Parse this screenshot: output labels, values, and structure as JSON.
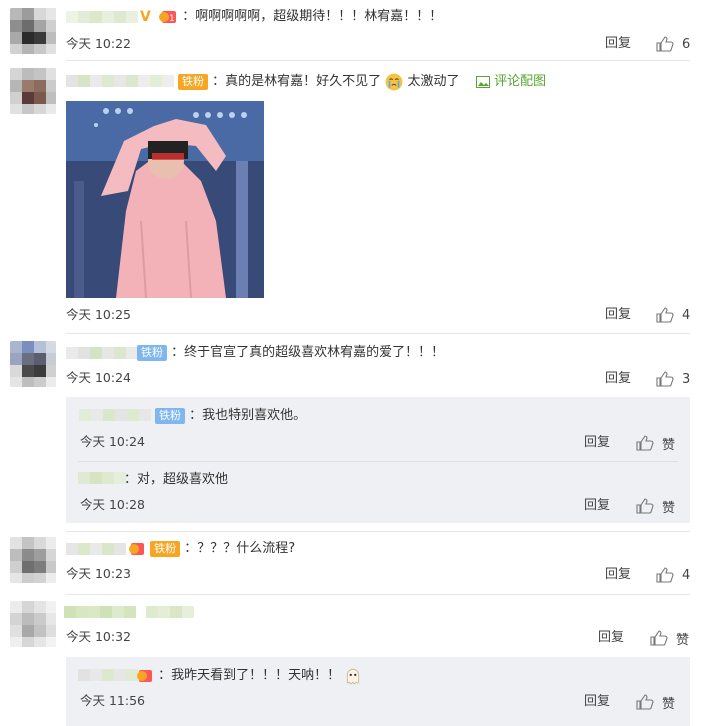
{
  "labels": {
    "reply": "回复",
    "like_zan": "赞",
    "img_link": "评论配图"
  },
  "comments": [
    {
      "text": "：啊啊啊啊啊，超级期待！！！林宥嘉！！！",
      "time": "今天 10:22",
      "likes": "6"
    },
    {
      "text": "：真的是林宥嘉！好久不见了",
      "text2": "太激动了",
      "badge": "铁粉",
      "time": "今天 10:25",
      "likes": "4"
    },
    {
      "text": "：终于官宣了真的超级喜欢林宥嘉的爱了！！！",
      "badge": "铁粉",
      "time": "今天 10:24",
      "likes": "3",
      "replies": [
        {
          "text": "：我也特别喜欢他。",
          "badge": "铁粉",
          "time": "今天 10:24"
        },
        {
          "text": "：对，超级喜欢他",
          "time": "今天 10:28"
        }
      ]
    },
    {
      "text": "：？？？什么流程?",
      "badge": "铁粉",
      "time": "今天 10:23",
      "likes": "4"
    },
    {
      "time": "今天 10:32",
      "replies": [
        {
          "text": "：我昨天看到了！！！天呐！！",
          "time": "今天 11:56"
        }
      ]
    }
  ],
  "colors": {
    "accent_orange": "#f7a623",
    "badge_blue": "#7fb6ef",
    "link_green": "#55a532",
    "reply_bg": "#eef0f3"
  },
  "icons": [
    "thumb-up-icon",
    "picture-icon",
    "crying-emoji-icon",
    "ghost-emoji-icon",
    "verified-v-icon",
    "fan-heart-icon"
  ]
}
